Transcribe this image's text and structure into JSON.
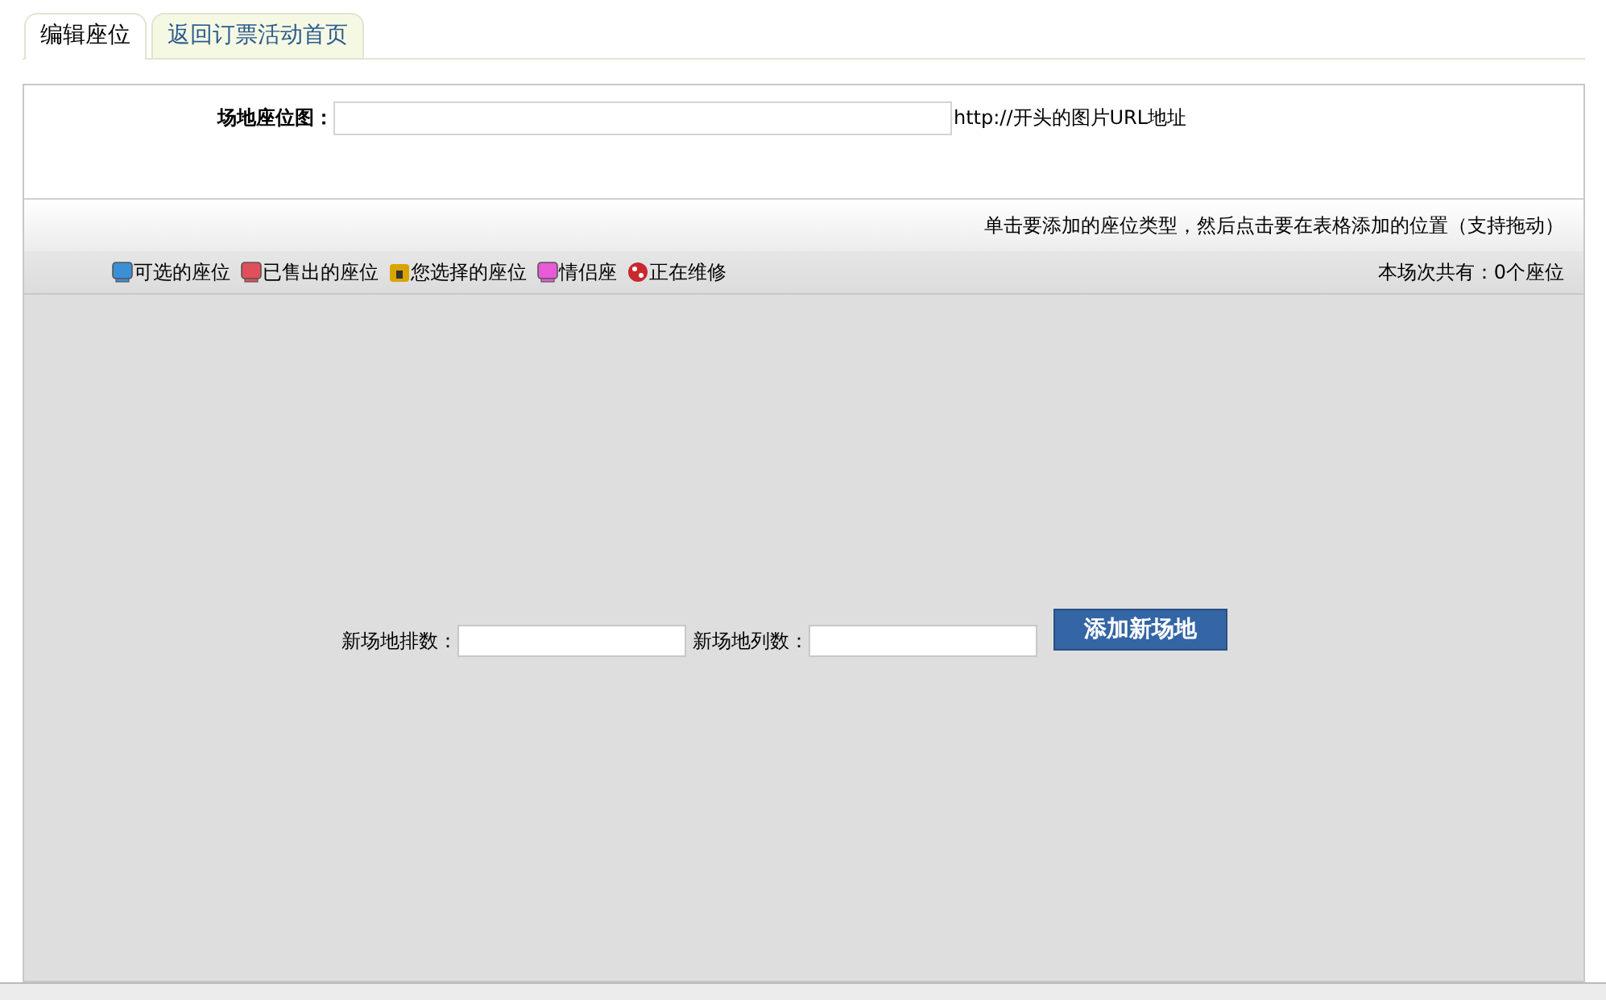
{
  "tabs": [
    {
      "label": "编辑座位",
      "selected": true
    },
    {
      "label": "返回订票活动首页",
      "selected": false
    }
  ],
  "map_field": {
    "label": "场地座位图：",
    "hint": "http://开头的图片URL地址"
  },
  "instruction": "单击要添加的座位类型，然后点击要在表格添加的位置（支持拖动）",
  "legend": [
    {
      "kind": "seat",
      "color": "#3b8fd6",
      "label": "可选的座位"
    },
    {
      "kind": "seat",
      "color": "#e0505a",
      "label": "已售出的座位"
    },
    {
      "kind": "lock",
      "color": "#d9a400",
      "label": "您选择的座位"
    },
    {
      "kind": "seat",
      "color": "#e85ad8",
      "label": "情侣座"
    },
    {
      "kind": "repair",
      "color": "#c8282e",
      "label": "正在维修"
    }
  ],
  "seat_count": "本场次共有：0个座位",
  "new_venue": {
    "rows_label": "新场地排数：",
    "cols_label": "新场地列数：",
    "button": "添加新场地"
  }
}
